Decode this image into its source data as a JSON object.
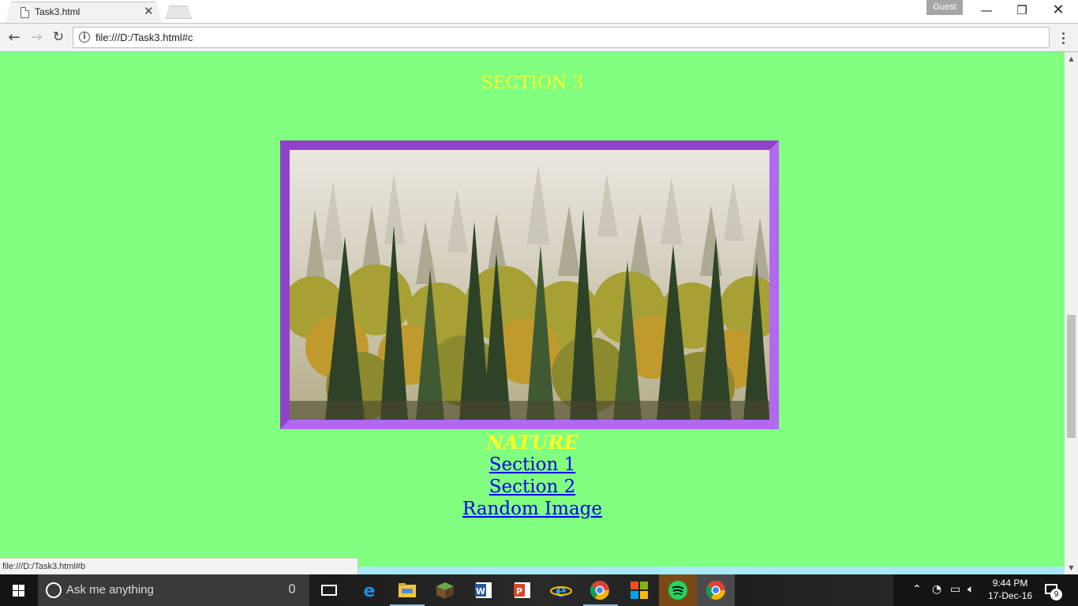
{
  "browser": {
    "tab_title": "Task3.html",
    "guest_label": "Guest",
    "url": "file:///D:/Task3.html#c",
    "status_url": "file:///D:/Task3.html#b"
  },
  "page": {
    "section_heading": "SECTION 3",
    "image_caption": "NATURE",
    "links": [
      "Section 1",
      "Section 2",
      "Random Image"
    ],
    "colors": {
      "background": "#80ff80",
      "heading": "#ffff26",
      "link": "#0000ee",
      "frame": "#b368f0"
    }
  },
  "taskbar": {
    "search_placeholder": "Ask me anything",
    "apps": [
      "task-view",
      "edge",
      "file-explorer",
      "minecraft",
      "word",
      "powerpoint",
      "internet-explorer",
      "chrome",
      "windows-app",
      "spotify",
      "chrome"
    ],
    "time": "9:44 PM",
    "date": "17-Dec-16",
    "notification_count": "9"
  }
}
